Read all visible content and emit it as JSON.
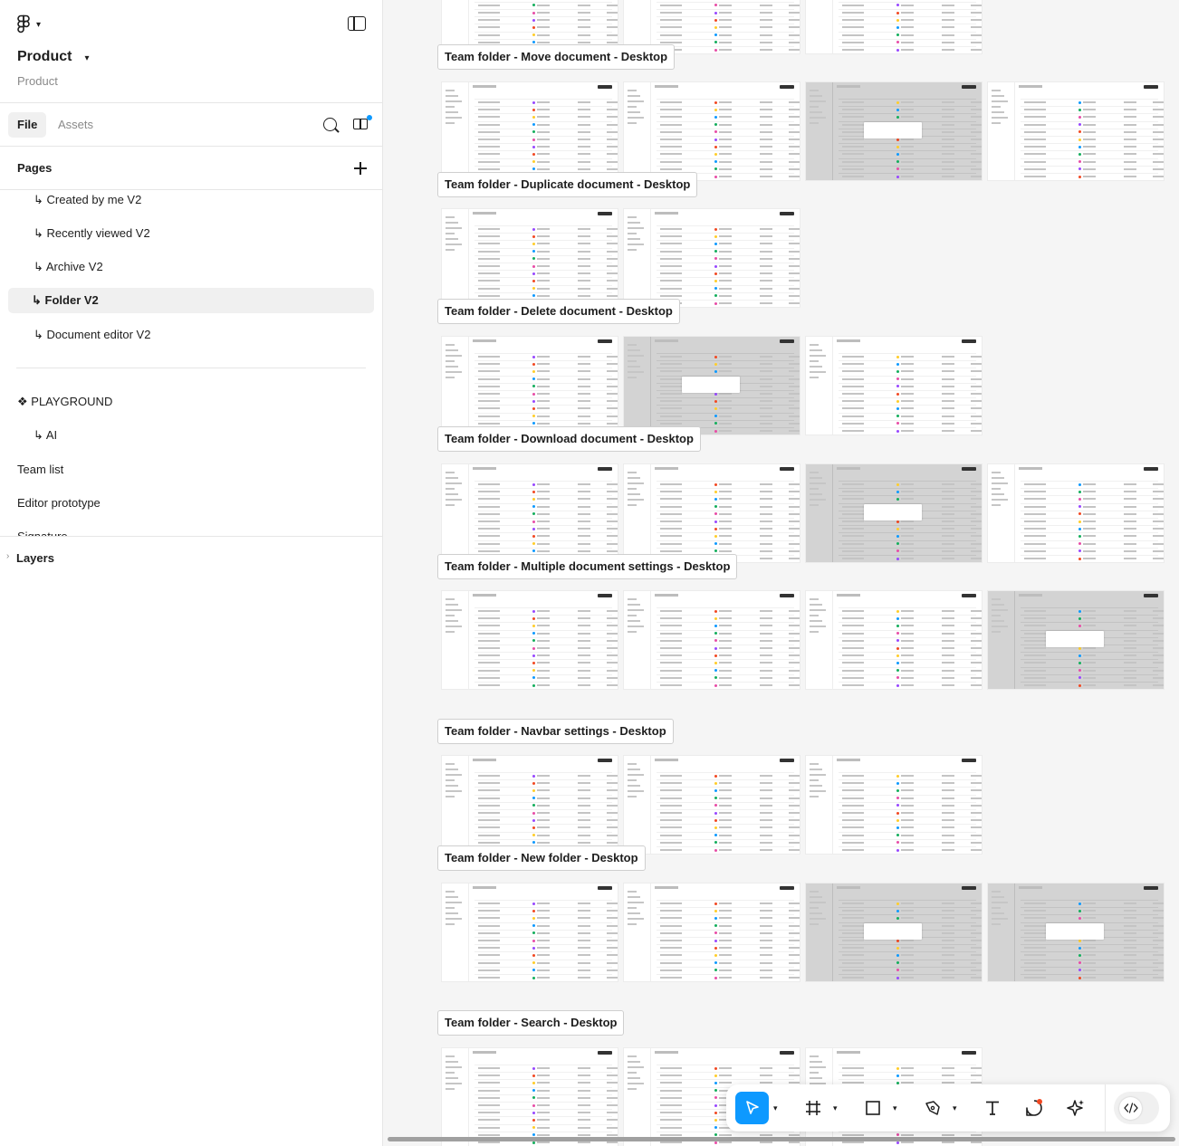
{
  "app": {
    "project_name": "Product",
    "project_subtitle": "Product"
  },
  "tabs": {
    "file": "File",
    "assets": "Assets"
  },
  "pages": {
    "header": "Pages",
    "items": [
      {
        "label": "Created by me V2",
        "prefix": "↳"
      },
      {
        "label": "Recently viewed V2",
        "prefix": "↳"
      },
      {
        "label": "Archive V2",
        "prefix": "↳"
      },
      {
        "label": "Folder V2",
        "prefix": "↳",
        "selected": true
      },
      {
        "label": "Document editor V2",
        "prefix": "↳"
      },
      {
        "label": "PLAYGROUND",
        "prefix": "❖"
      },
      {
        "label": "AI",
        "prefix": "↳"
      },
      {
        "label": "Team list"
      },
      {
        "label": "Editor prototype"
      },
      {
        "label": "Signature"
      }
    ]
  },
  "layers": {
    "label": "Layers"
  },
  "canvas": {
    "sections": [
      {
        "label": "Team folder - Move document  - Desktop"
      },
      {
        "label": "Team folder - Duplicate document  - Desktop"
      },
      {
        "label": "Team folder - Delete document  - Desktop"
      },
      {
        "label": "Team folder - Download document  - Desktop"
      },
      {
        "label": "Team folder - Multiple document settings  - Desktop"
      },
      {
        "label": "Team folder - Navbar settings  - Desktop"
      },
      {
        "label": "Team folder - New folder  - Desktop"
      },
      {
        "label": "Team folder - Search - Desktop"
      }
    ]
  },
  "toolbar": {
    "tools": [
      {
        "name": "move-tool",
        "icon": "cursor-icon",
        "active": true
      },
      {
        "name": "frame-tool",
        "icon": "frame-icon"
      },
      {
        "name": "shape-tool",
        "icon": "rectangle-icon"
      },
      {
        "name": "pen-tool",
        "icon": "pen-icon"
      },
      {
        "name": "text-tool",
        "icon": "text-icon"
      },
      {
        "name": "comment-tool",
        "icon": "comment-icon"
      },
      {
        "name": "actions-tool",
        "icon": "sparkle-icon"
      },
      {
        "name": "dev-mode-toggle",
        "icon": "code-icon"
      }
    ],
    "accent": "#0d99ff",
    "notification_dot": "#f24822"
  }
}
